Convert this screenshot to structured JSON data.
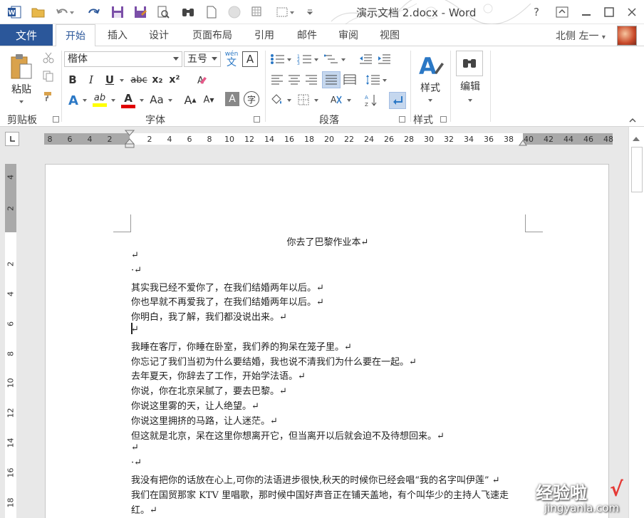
{
  "app": {
    "title": "演示文档 2.docx - Word",
    "user": "北侧 左一"
  },
  "tabs": {
    "file": "文件",
    "items": [
      "开始",
      "插入",
      "设计",
      "页面布局",
      "引用",
      "邮件",
      "审阅",
      "视图"
    ],
    "active": "开始"
  },
  "ribbon": {
    "clipboard": {
      "paste_label": "粘贴",
      "group_label": "剪贴板"
    },
    "font": {
      "font_name": "楷体",
      "font_size": "五号",
      "group_label": "字体",
      "bold": "B",
      "italic": "I",
      "underline": "U",
      "strike": "abc",
      "subscript": "x₂",
      "superscript": "x²",
      "char_shading": "A",
      "pinyin_top": "wén",
      "pinyin_bottom": "文",
      "text_effect": "A",
      "highlight": "ab",
      "font_color": "A",
      "case": "Aa",
      "grow": "A",
      "shrink": "A",
      "enclose": "字"
    },
    "paragraph": {
      "group_label": "段落"
    },
    "styles": {
      "label": "样式",
      "group_label": "样式"
    },
    "editing": {
      "label": "编辑"
    }
  },
  "colors": {
    "brand": "#2b579a",
    "highlight_yellow": "#ffff00",
    "font_red": "#e00000",
    "accent_blue": "#2b78c5"
  },
  "ruler": {
    "h_left": [
      "8",
      "6",
      "4",
      "2"
    ],
    "h_right": [
      "2",
      "4",
      "6",
      "8",
      "10",
      "12",
      "14",
      "16",
      "18",
      "20",
      "22",
      "24",
      "26",
      "28",
      "30",
      "32",
      "34",
      "36",
      "38",
      "40",
      "42",
      "44",
      "46",
      "48"
    ],
    "v_top": [
      "4",
      "2"
    ],
    "v_body": [
      "2",
      "4",
      "6",
      "8",
      "10",
      "12",
      "14",
      "16",
      "18"
    ]
  },
  "document": {
    "heading": "你去了巴黎作业本↵",
    "lines": [
      "↵",
      "·↵",
      "其实我已经不爱你了，在我们结婚两年以后。↵",
      "你也早就不再爱我了，在我们结婚两年以后。↵",
      "你明白，我了解，我们都没说出来。↵",
      "↵",
      "我睡在客厅，你睡在卧室，我们养的狗呆在笼子里。↵",
      "你忘记了我们当初为什么要结婚，我也说不清我们为什么要在一起。↵",
      "去年夏天，你辞去了工作，开始学法语。↵",
      "你说，你在北京呆腻了，要去巴黎。↵",
      "你说这里雾的天，让人绝望。↵",
      "你说这里拥挤的马路，让人迷茫。↵",
      "但这就是北京，呆在这里你想离开它，但当离开以后就会迫不及待想回来。↵",
      "↵",
      "·↵",
      "我没有把你的话放在心上,可你的法语进步很快,秋天的时候你已经会唱“我的名字叫伊莲” ↵",
      "我们在国贸那家 KTV 里唱歌，那时候中国好声音正在铺天盖地，有个叫华少的主持人飞速走",
      "红。↵"
    ]
  },
  "watermark": {
    "main": "经验啦",
    "check": "√",
    "sub": "jingyanla.com"
  }
}
